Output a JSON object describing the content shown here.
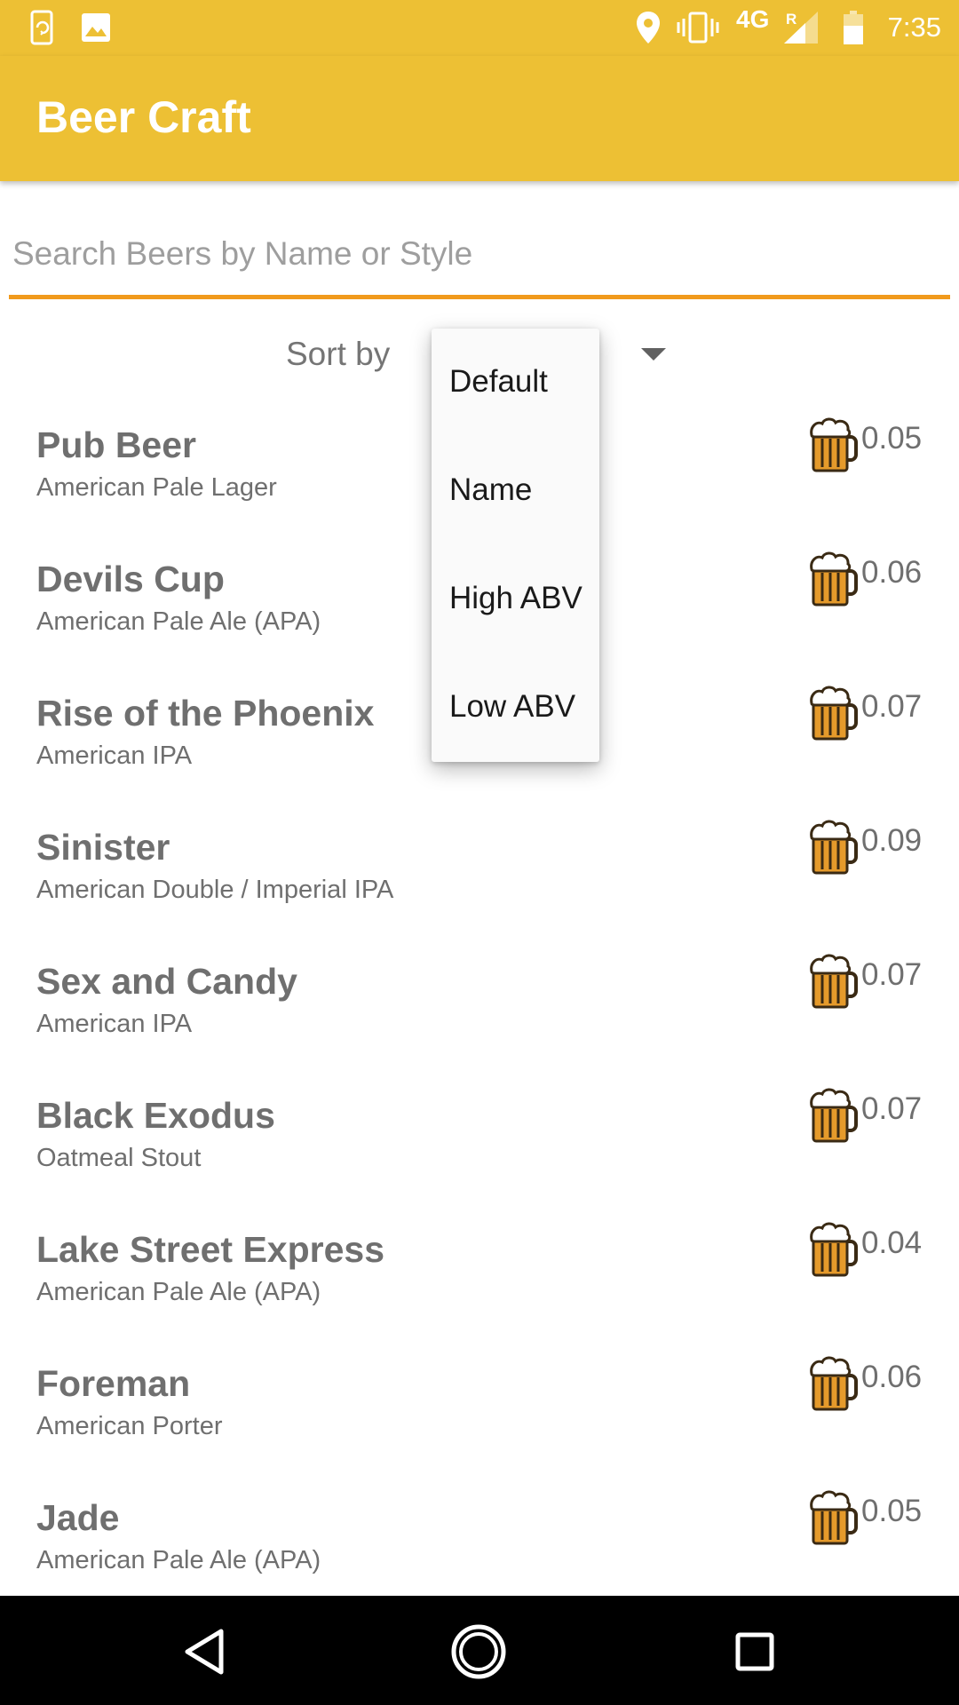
{
  "status_bar": {
    "time": "7:35",
    "network": "4G",
    "roaming": "R",
    "icons": [
      "phone-sync-icon",
      "image-icon",
      "location-icon",
      "vibrate-icon",
      "signal-icon",
      "battery-icon"
    ]
  },
  "app_bar": {
    "title": "Beer Craft",
    "color": "#EDC034"
  },
  "search": {
    "value": "",
    "placeholder": "Search Beers by Name or Style",
    "underline_color": "#F19A1C"
  },
  "sort": {
    "label": "Sort by",
    "options": [
      "Default",
      "Name",
      "High ABV",
      "Low ABV"
    ]
  },
  "beers": [
    {
      "name": "Pub Beer",
      "style": "American Pale Lager",
      "abv": "0.05"
    },
    {
      "name": "Devils Cup",
      "style": "American Pale Ale (APA)",
      "abv": "0.06"
    },
    {
      "name": "Rise of the Phoenix",
      "style": "American IPA",
      "abv": "0.07"
    },
    {
      "name": "Sinister",
      "style": "American Double / Imperial IPA",
      "abv": "0.09"
    },
    {
      "name": "Sex and Candy",
      "style": "American IPA",
      "abv": "0.07"
    },
    {
      "name": "Black Exodus",
      "style": "Oatmeal Stout",
      "abv": "0.07"
    },
    {
      "name": "Lake Street Express",
      "style": "American Pale Ale (APA)",
      "abv": "0.04"
    },
    {
      "name": "Foreman",
      "style": "American Porter",
      "abv": "0.06"
    },
    {
      "name": "Jade",
      "style": "American Pale Ale (APA)",
      "abv": "0.05"
    }
  ],
  "nav_bar": {
    "icons": [
      "back-icon",
      "home-icon",
      "recents-icon"
    ]
  }
}
